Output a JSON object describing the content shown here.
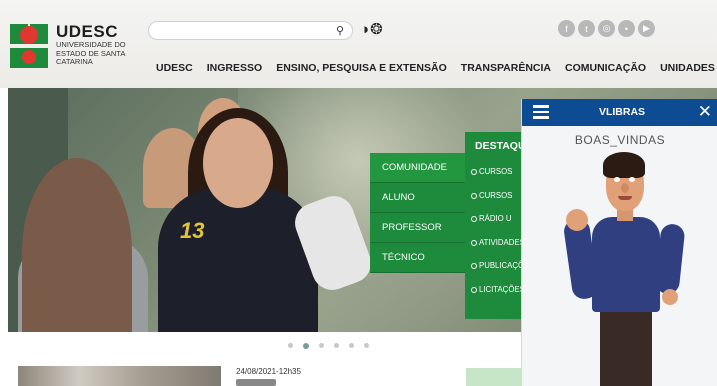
{
  "header": {
    "logo": {
      "title": "UDESC",
      "subtitle": "UNIVERSIDADE DO ESTADO DE SANTA CATARINA"
    },
    "search": {
      "placeholder": "",
      "icon": "search-icon"
    },
    "language_icons": [
      "contrast-icon",
      "globe-icon"
    ],
    "social_icons": [
      "facebook-icon",
      "twitter-icon",
      "instagram-icon",
      "flickr-icon",
      "youtube-icon"
    ],
    "nav": [
      "UDESC",
      "INGRESSO",
      "ENSINO, PESQUISA E EXTENSÃO",
      "TRANSPARÊNCIA",
      "COMUNICAÇÃO",
      "UNIDADES"
    ]
  },
  "profile_menu": [
    "COMUNIDADE",
    "ALUNO",
    "PROFESSOR",
    "TÉCNICO"
  ],
  "highlights": {
    "title": "DESTAQUES",
    "items": [
      "CURSOS",
      "CURSOS",
      "RÁDIO U",
      "ATIVIDADES",
      "PUBLICAÇÕES",
      "LICITAÇÕES"
    ]
  },
  "carousel": {
    "count": 6,
    "active": 1
  },
  "news": {
    "date": "24/08/2021-12h35"
  },
  "vlibras": {
    "title": "VLIBRAS",
    "word": "BOAS_VINDAS",
    "close": "✕"
  },
  "colors": {
    "brand_green": "#1e8a3c",
    "brand_red": "#e0382f",
    "vlibras_blue": "#0d4b92"
  }
}
